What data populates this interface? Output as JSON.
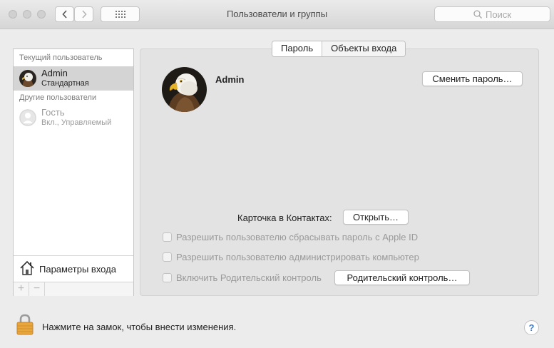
{
  "window": {
    "title": "Пользователи и группы",
    "search_placeholder": "Поиск"
  },
  "tabs": [
    {
      "label": "Пароль",
      "active": true
    },
    {
      "label": "Объекты входа",
      "active": false
    }
  ],
  "sidebar": {
    "current_user_header": "Текущий пользователь",
    "current_user": {
      "name": "Admin",
      "role": "Стандартная"
    },
    "other_users_header": "Другие пользователи",
    "other_users": [
      {
        "name": "Гость",
        "status": "Вкл., Управляемый"
      }
    ],
    "login_options_label": "Параметры входа",
    "add_label": "+",
    "remove_label": "−"
  },
  "user_panel": {
    "user_name": "Admin",
    "change_password_label": "Сменить пароль…",
    "contacts_card_label": "Карточка в Контактах:",
    "open_button_label": "Открыть…",
    "checkboxes": [
      {
        "label": "Разрешить пользователю сбрасывать пароль с Apple ID",
        "checked": false,
        "enabled": false
      },
      {
        "label": "Разрешить пользователю администрировать компьютер",
        "checked": false,
        "enabled": false
      },
      {
        "label": "Включить Родительский контроль",
        "checked": false,
        "enabled": false
      }
    ],
    "parental_controls_button_label": "Родительский контроль…"
  },
  "footer": {
    "lock_text": "Нажмите на замок, чтобы внести изменения.",
    "help_label": "?"
  }
}
